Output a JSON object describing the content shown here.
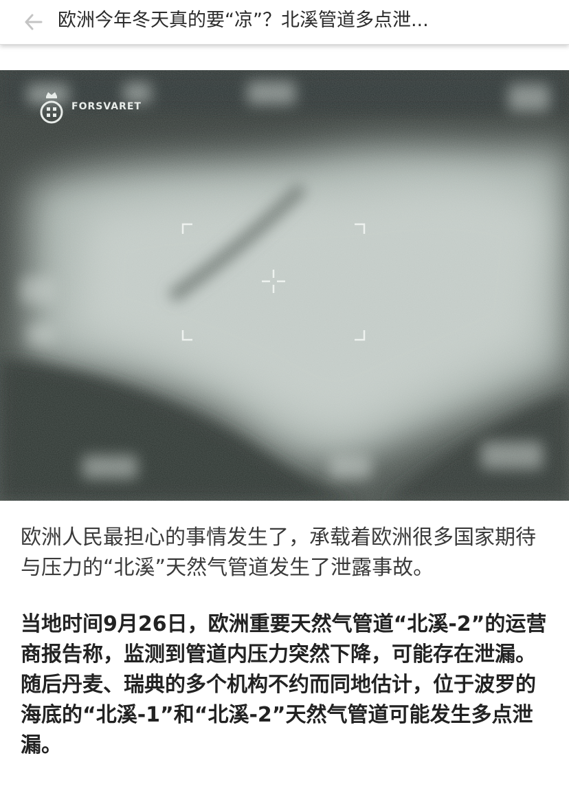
{
  "header": {
    "title": "欧洲今年冬天真的要“凉”？北溪管道多点泄...",
    "back_icon": "arrow-left-icon"
  },
  "hero_image": {
    "watermark": "FORSVARET",
    "logo_icon": "crown-shield-logo-icon",
    "reticle_icon": "crosshair-icon"
  },
  "article": {
    "paragraphs": [
      "欧洲人民最担心的事情发生了，承载着欧洲很多国家期待与压力的“北溪”天然气管道发生了泄露事故。",
      "当地时间9月26日，欧洲重要天然气管道“北溪-2”的运营商报告称，监测到管道内压力突然下降，可能存在泄漏。随后丹麦、瑞典的多个机构不约而同地估计，位于波罗的海底的“北溪-1”和“北溪-2”天然气管道可能发生多点泄漏。"
    ]
  },
  "colors": {
    "text_primary": "#222222",
    "text_secondary": "#3a3a3a",
    "sea_dark": "#3d4340",
    "foam": "#b9c1bd"
  }
}
